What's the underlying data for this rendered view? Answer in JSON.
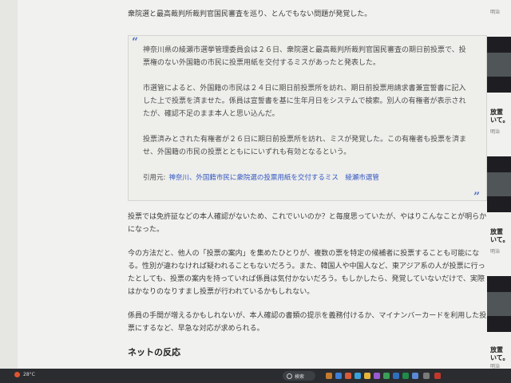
{
  "article": {
    "lead": "衆院選と最高裁判所裁判官国民審査を巡り、とんでもない問題が発覚した。",
    "quote": {
      "open_mark": "“",
      "close_mark": "”",
      "paragraphs": [
        "神奈川県の綾瀬市選挙管理委員会は２６日、衆院選と最高裁判所裁判官国民審査の期日前投票で、投票権のない外国籍の市民に投票用紙を交付するミスがあったと発表した。",
        "市選管によると、外国籍の市民は２４日に期日前投票所を訪れ、期日前投票用請求書兼宣誓書に記入した上で投票を済ませた。係員は宣誓書を基に生年月日をシステムで検索。別人の有権者が表示されたが、確認不足のまま本人と思い込んだ。",
        "投票済みとされた有権者が２６日に期日前投票所を訪れ、ミスが発覚した。この有権者も投票を済ませ、外国籍の市民の投票とともににいずれも有効となるという。"
      ],
      "cite_label": "引用元:",
      "cite_link": "神奈川、外国籍市民に衆院選の投票用紙を交付するミス　綾瀬市選管"
    },
    "paragraphs": [
      "投票では免許証などの本人確認がないため、これでいいのか？と毎度思っていたが、やはりこんなことが明らかになった。",
      "今の方法だと、他人の「投票の案内」を集めたひとりが、複数の票を特定の候補者に投票することも可能になる。性別が違わなければ疑われることもないだろう。また、韓国人や中国人など、東アジア系の人が投票に行ったとしても、投票の案内を持っていれば係員は気付かないだろう。もしかしたら、発覚していないだけで、実際はかなりのなりすまし投票が行われているかもしれない。",
      "係員の手間が増えるかもしれないが、本人確認の書類の提示を義務付けるか、マイナンバーカードを利用した投票にするなど、早急な対応が求められる。"
    ],
    "section_heading": "ネットの反応"
  },
  "sidebar": {
    "items": [
      {
        "title": "",
        "sub": "明治"
      },
      {
        "title": "放置",
        "title2": "いて。",
        "sub": "明治"
      },
      {
        "title": "放置",
        "title2": "いて。",
        "sub": "明治"
      },
      {
        "title": "放置",
        "title2": "いて。",
        "sub": "明治"
      }
    ]
  },
  "taskbar": {
    "weather": "28°C",
    "search_label": "検索"
  },
  "colors": {
    "accent_link": "#3458c2",
    "quote_mark": "#4a6fc4"
  }
}
